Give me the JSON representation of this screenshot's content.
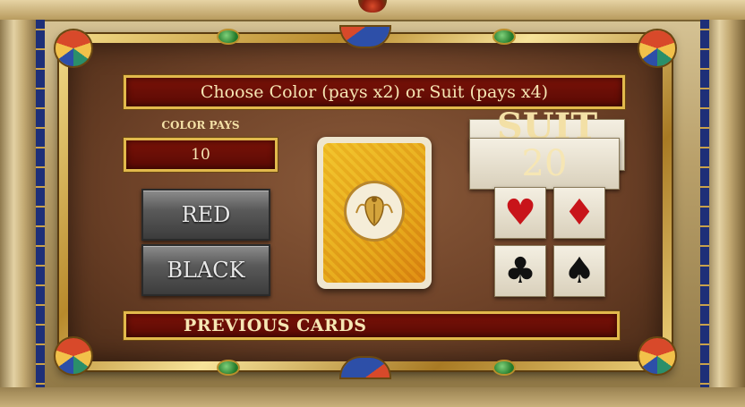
{
  "dialog": {
    "title": "Choose Color (pays x2) or Suit (pays x4)",
    "color_pays_label": "COLOR PAYS",
    "color_pays_value": "10",
    "suit_pays_label": "SUIT PAYS",
    "suit_pays_value": "20",
    "buttons": {
      "red": "RED",
      "black": "BLACK"
    },
    "previous_cards_label": "PREVIOUS CARDS",
    "card_back_icon": "scarab-icon"
  },
  "suits": {
    "heart": "♥",
    "diamond": "♦",
    "club": "♣",
    "spade": "♠"
  },
  "colors": {
    "bar_red": "#7a1208",
    "gold": "#e2b94c",
    "suit_red": "#c8141a"
  }
}
